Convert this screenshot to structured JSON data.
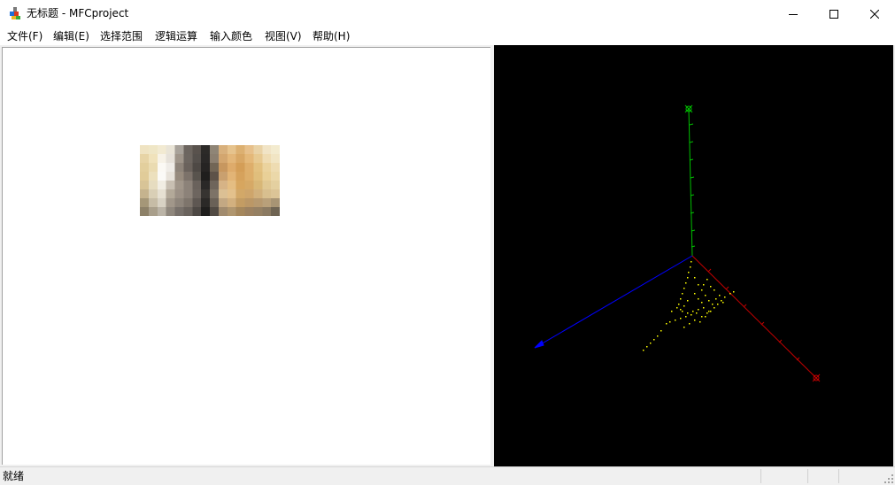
{
  "window": {
    "title": "无标题 - MFCproject",
    "icon": "mfc-app-icon",
    "caption_buttons": [
      "minimize-icon",
      "maximize-icon",
      "close-icon"
    ]
  },
  "menu": {
    "items": [
      {
        "label": "文件(F)"
      },
      {
        "label": "编辑(E)"
      },
      {
        "label": "选择范围"
      },
      {
        "label": "逻辑运算"
      },
      {
        "label": "输入颜色"
      },
      {
        "label": "视图(V)"
      },
      {
        "label": "帮助(H)"
      }
    ]
  },
  "left_view": {
    "image_thumbnail": "pixelated-color-swatch-image"
  },
  "right_view": {
    "background": "#000000",
    "axes": {
      "x_color": "#c00000",
      "y_color": "#00c000",
      "z_color": "#0000ff"
    },
    "points_color": "#ffff00"
  },
  "status": {
    "text": "就绪"
  }
}
